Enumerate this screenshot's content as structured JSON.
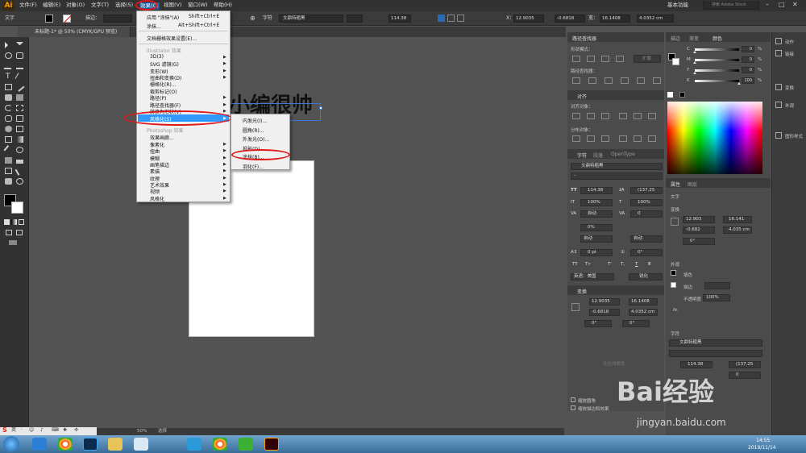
{
  "app": {
    "logo": "Ai"
  },
  "menubar": {
    "items": [
      "文件(F)",
      "编辑(E)",
      "对象(O)",
      "文字(T)",
      "选择(S)",
      "效果(C)",
      "视图(V)",
      "窗口(W)",
      "帮助(H)"
    ],
    "workspace": "基本功能",
    "search_placeholder": "搜索 Adobe Stock"
  },
  "toolbar": {
    "left_label": "文字",
    "stroke_label": "描边：",
    "char_label": "字符",
    "font_name": "文鼎特粗黑",
    "font_size": "114.38",
    "x_label": "X：",
    "x_value": "12.9035",
    "y_value": "-0.6818",
    "w_label": "宽：",
    "w_value": "16.1408",
    "h_value": "4.0352 cm"
  },
  "document": {
    "tab_title": "未标题-1* @ 50% (CMYK/GPU 预览)",
    "artboard_text": "小编很帅"
  },
  "effect_menu": {
    "items": [
      {
        "label": "应用 \"涂抹\"(A)",
        "shortcut": "Shift+Ctrl+E"
      },
      {
        "label": "涂抹...",
        "shortcut": "Alt+Shift+Ctrl+E"
      },
      {
        "label": "文档栅格效果设置(E)..."
      }
    ],
    "illustrator_header": "Illustrator 效果",
    "illustrator_items": [
      "3D(3)",
      "SVG 滤镜(G)",
      "变形(W)",
      "扭曲和变换(D)",
      "栅格化(R)...",
      "裁剪标记(O)",
      "路径(P)",
      "路径查找器(F)",
      "转换为形状(V)",
      "风格化(S)"
    ],
    "photoshop_header": "Photoshop 效果",
    "photoshop_items": [
      "效果画廊...",
      "像素化",
      "扭曲",
      "模糊",
      "画笔描边",
      "素描",
      "纹理",
      "艺术效果",
      "视频",
      "风格化"
    ]
  },
  "stylize_submenu": {
    "items": [
      "内发光(I)...",
      "圆角(R)...",
      "外发光(O)...",
      "投影(D)...",
      "涂抹(B)...",
      "羽化(F)..."
    ]
  },
  "panels": {
    "pathfinder": {
      "title": "路径查找器",
      "shape_mode": "形状模式：",
      "pathfinder_label": "路径查找器：",
      "expand": "扩展"
    },
    "align": {
      "title": "对齐",
      "align_objects": "对齐对象：",
      "distribute_objects": "分布对象："
    },
    "character": {
      "tabs": [
        "字符",
        "段落",
        "OpenType"
      ],
      "font": "文鼎特粗黑",
      "style": "-",
      "size": "114.38",
      "leading": "(137.25",
      "scale_h": "100%",
      "scale_v": "100%",
      "kerning": "自动",
      "tracking": "0",
      "baseline": "0%",
      "aki_left": "自动",
      "aki_right": "自动",
      "shift": "0 pt",
      "rotate": "0°",
      "language": "英语：美国",
      "antialias": "锐化"
    },
    "transform": {
      "title": "变换",
      "x": "12.9035",
      "y": "-0.6818",
      "w": "16.1408",
      "h": "4.0352 cm",
      "angle": "0°",
      "shear": "0°"
    },
    "bottom_checks": [
      "缩放圆角",
      "缩放描边和效果"
    ],
    "empty_hint": "无在线属性"
  },
  "color_panel": {
    "tabs": [
      "描边",
      "渐变",
      "颜色"
    ],
    "channels": [
      {
        "k": "C",
        "v": "0"
      },
      {
        "k": "M",
        "v": "0"
      },
      {
        "k": "Y",
        "v": "0"
      },
      {
        "k": "K",
        "v": "100"
      }
    ],
    "unit": "%"
  },
  "properties_panel": {
    "tabs": [
      "属性",
      "图层"
    ],
    "section_text": "文字",
    "section_transform": "变换",
    "x": "12.903",
    "y": "-0.682",
    "w": "16.141",
    "h": "4.035 cm",
    "angle": "0°",
    "section_appearance": "外观",
    "fill_label": "填色",
    "stroke_label": "描边",
    "opacity_label": "不透明度",
    "opacity": "100%",
    "fx": "fx.",
    "section_char": "字符",
    "font": "文鼎特粗黑",
    "size": "114.38",
    "leading": "(137.25",
    "tracking": "0"
  },
  "far_right": {
    "items": [
      "动作",
      "链接",
      "变换",
      "外观",
      "图形样式"
    ]
  },
  "statusbar": {
    "zoom": "50%",
    "tool": "选择"
  },
  "taskbar": {
    "time": "14:55",
    "date": "2019/11/14"
  },
  "watermark": {
    "brand": "Bai经验",
    "url": "jingyan.baidu.com"
  }
}
